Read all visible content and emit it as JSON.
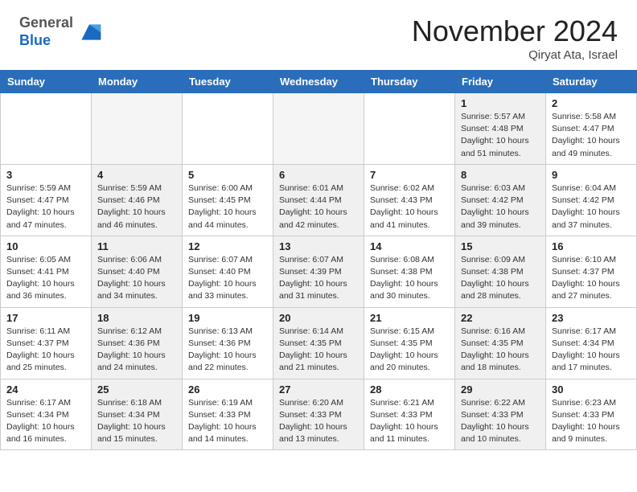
{
  "header": {
    "logo_general": "General",
    "logo_blue": "Blue",
    "month_title": "November 2024",
    "location": "Qiryat Ata, Israel"
  },
  "weekdays": [
    "Sunday",
    "Monday",
    "Tuesday",
    "Wednesday",
    "Thursday",
    "Friday",
    "Saturday"
  ],
  "weeks": [
    [
      {
        "day": "",
        "info": ""
      },
      {
        "day": "",
        "info": ""
      },
      {
        "day": "",
        "info": ""
      },
      {
        "day": "",
        "info": ""
      },
      {
        "day": "",
        "info": ""
      },
      {
        "day": "1",
        "info": "Sunrise: 5:57 AM\nSunset: 4:48 PM\nDaylight: 10 hours\nand 51 minutes."
      },
      {
        "day": "2",
        "info": "Sunrise: 5:58 AM\nSunset: 4:47 PM\nDaylight: 10 hours\nand 49 minutes."
      }
    ],
    [
      {
        "day": "3",
        "info": "Sunrise: 5:59 AM\nSunset: 4:47 PM\nDaylight: 10 hours\nand 47 minutes."
      },
      {
        "day": "4",
        "info": "Sunrise: 5:59 AM\nSunset: 4:46 PM\nDaylight: 10 hours\nand 46 minutes."
      },
      {
        "day": "5",
        "info": "Sunrise: 6:00 AM\nSunset: 4:45 PM\nDaylight: 10 hours\nand 44 minutes."
      },
      {
        "day": "6",
        "info": "Sunrise: 6:01 AM\nSunset: 4:44 PM\nDaylight: 10 hours\nand 42 minutes."
      },
      {
        "day": "7",
        "info": "Sunrise: 6:02 AM\nSunset: 4:43 PM\nDaylight: 10 hours\nand 41 minutes."
      },
      {
        "day": "8",
        "info": "Sunrise: 6:03 AM\nSunset: 4:42 PM\nDaylight: 10 hours\nand 39 minutes."
      },
      {
        "day": "9",
        "info": "Sunrise: 6:04 AM\nSunset: 4:42 PM\nDaylight: 10 hours\nand 37 minutes."
      }
    ],
    [
      {
        "day": "10",
        "info": "Sunrise: 6:05 AM\nSunset: 4:41 PM\nDaylight: 10 hours\nand 36 minutes."
      },
      {
        "day": "11",
        "info": "Sunrise: 6:06 AM\nSunset: 4:40 PM\nDaylight: 10 hours\nand 34 minutes."
      },
      {
        "day": "12",
        "info": "Sunrise: 6:07 AM\nSunset: 4:40 PM\nDaylight: 10 hours\nand 33 minutes."
      },
      {
        "day": "13",
        "info": "Sunrise: 6:07 AM\nSunset: 4:39 PM\nDaylight: 10 hours\nand 31 minutes."
      },
      {
        "day": "14",
        "info": "Sunrise: 6:08 AM\nSunset: 4:38 PM\nDaylight: 10 hours\nand 30 minutes."
      },
      {
        "day": "15",
        "info": "Sunrise: 6:09 AM\nSunset: 4:38 PM\nDaylight: 10 hours\nand 28 minutes."
      },
      {
        "day": "16",
        "info": "Sunrise: 6:10 AM\nSunset: 4:37 PM\nDaylight: 10 hours\nand 27 minutes."
      }
    ],
    [
      {
        "day": "17",
        "info": "Sunrise: 6:11 AM\nSunset: 4:37 PM\nDaylight: 10 hours\nand 25 minutes."
      },
      {
        "day": "18",
        "info": "Sunrise: 6:12 AM\nSunset: 4:36 PM\nDaylight: 10 hours\nand 24 minutes."
      },
      {
        "day": "19",
        "info": "Sunrise: 6:13 AM\nSunset: 4:36 PM\nDaylight: 10 hours\nand 22 minutes."
      },
      {
        "day": "20",
        "info": "Sunrise: 6:14 AM\nSunset: 4:35 PM\nDaylight: 10 hours\nand 21 minutes."
      },
      {
        "day": "21",
        "info": "Sunrise: 6:15 AM\nSunset: 4:35 PM\nDaylight: 10 hours\nand 20 minutes."
      },
      {
        "day": "22",
        "info": "Sunrise: 6:16 AM\nSunset: 4:35 PM\nDaylight: 10 hours\nand 18 minutes."
      },
      {
        "day": "23",
        "info": "Sunrise: 6:17 AM\nSunset: 4:34 PM\nDaylight: 10 hours\nand 17 minutes."
      }
    ],
    [
      {
        "day": "24",
        "info": "Sunrise: 6:17 AM\nSunset: 4:34 PM\nDaylight: 10 hours\nand 16 minutes."
      },
      {
        "day": "25",
        "info": "Sunrise: 6:18 AM\nSunset: 4:34 PM\nDaylight: 10 hours\nand 15 minutes."
      },
      {
        "day": "26",
        "info": "Sunrise: 6:19 AM\nSunset: 4:33 PM\nDaylight: 10 hours\nand 14 minutes."
      },
      {
        "day": "27",
        "info": "Sunrise: 6:20 AM\nSunset: 4:33 PM\nDaylight: 10 hours\nand 13 minutes."
      },
      {
        "day": "28",
        "info": "Sunrise: 6:21 AM\nSunset: 4:33 PM\nDaylight: 10 hours\nand 11 minutes."
      },
      {
        "day": "29",
        "info": "Sunrise: 6:22 AM\nSunset: 4:33 PM\nDaylight: 10 hours\nand 10 minutes."
      },
      {
        "day": "30",
        "info": "Sunrise: 6:23 AM\nSunset: 4:33 PM\nDaylight: 10 hours\nand 9 minutes."
      }
    ]
  ]
}
